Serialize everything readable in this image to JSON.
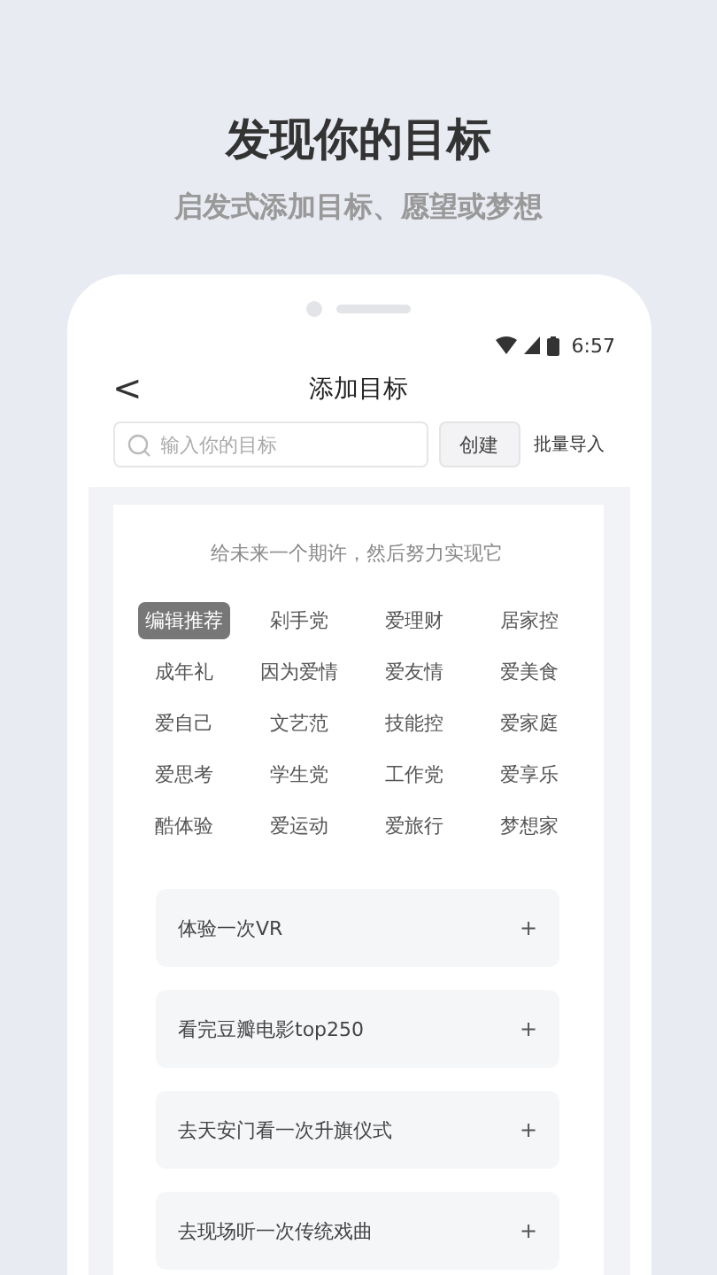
{
  "headline": "发现你的目标",
  "subheadline": "启发式添加目标、愿望或梦想",
  "status_bar": {
    "time": "6:57"
  },
  "nav": {
    "back": "<",
    "title": "添加目标"
  },
  "search": {
    "placeholder": "输入你的目标",
    "create_button": "创建",
    "import_link": "批量导入"
  },
  "prompt": "给未来一个期许，然后努力实现它",
  "tags": [
    {
      "label": "编辑推荐",
      "selected": true
    },
    {
      "label": "剁手党",
      "selected": false
    },
    {
      "label": "爱理财",
      "selected": false
    },
    {
      "label": "居家控",
      "selected": false
    },
    {
      "label": "成年礼",
      "selected": false
    },
    {
      "label": "因为爱情",
      "selected": false
    },
    {
      "label": "爱友情",
      "selected": false
    },
    {
      "label": "爱美食",
      "selected": false
    },
    {
      "label": "爱自己",
      "selected": false
    },
    {
      "label": "文艺范",
      "selected": false
    },
    {
      "label": "技能控",
      "selected": false
    },
    {
      "label": "爱家庭",
      "selected": false
    },
    {
      "label": "爱思考",
      "selected": false
    },
    {
      "label": "学生党",
      "selected": false
    },
    {
      "label": "工作党",
      "selected": false
    },
    {
      "label": "爱享乐",
      "selected": false
    },
    {
      "label": "酷体验",
      "selected": false
    },
    {
      "label": "爱运动",
      "selected": false
    },
    {
      "label": "爱旅行",
      "selected": false
    },
    {
      "label": "梦想家",
      "selected": false
    }
  ],
  "goals": [
    {
      "title": "体验一次VR",
      "add": "+"
    },
    {
      "title": "看完豆瓣电影top250",
      "add": "+"
    },
    {
      "title": "去天安门看一次升旗仪式",
      "add": "+"
    },
    {
      "title": "去现场听一次传统戏曲",
      "add": "+"
    }
  ]
}
